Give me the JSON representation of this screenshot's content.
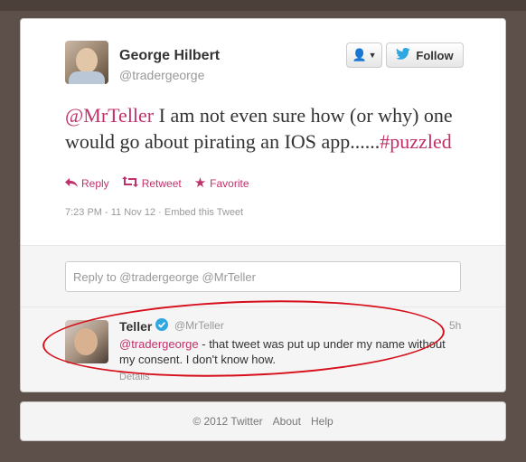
{
  "tweet": {
    "author_name": "George Hilbert",
    "author_handle": "@tradergeorge",
    "follow_label": "Follow",
    "text_mention": "@MrTeller",
    "text_body": " I am not even sure how (or why) one would go about pirating an IOS app......",
    "text_hashtag": "#puzzled",
    "actions": {
      "reply": "Reply",
      "retweet": "Retweet",
      "favorite": "Favorite"
    },
    "timestamp": "7:23 PM - 11 Nov 12",
    "embed": "Embed this Tweet"
  },
  "reply_box": {
    "placeholder": "Reply to @tradergeorge @MrTeller"
  },
  "reply": {
    "author_name": "Teller",
    "author_handle": "@MrTeller",
    "time": "5h",
    "mention": "@tradergeorge",
    "text": " - that tweet was put up under my name without my consent. I don't know how.",
    "details": "Details"
  },
  "footer": {
    "copyright": "© 2012 Twitter",
    "about": "About",
    "help": "Help"
  },
  "colors": {
    "accent": "#c0306a",
    "background": "#5d4f49",
    "highlight": "#d60f1b"
  }
}
